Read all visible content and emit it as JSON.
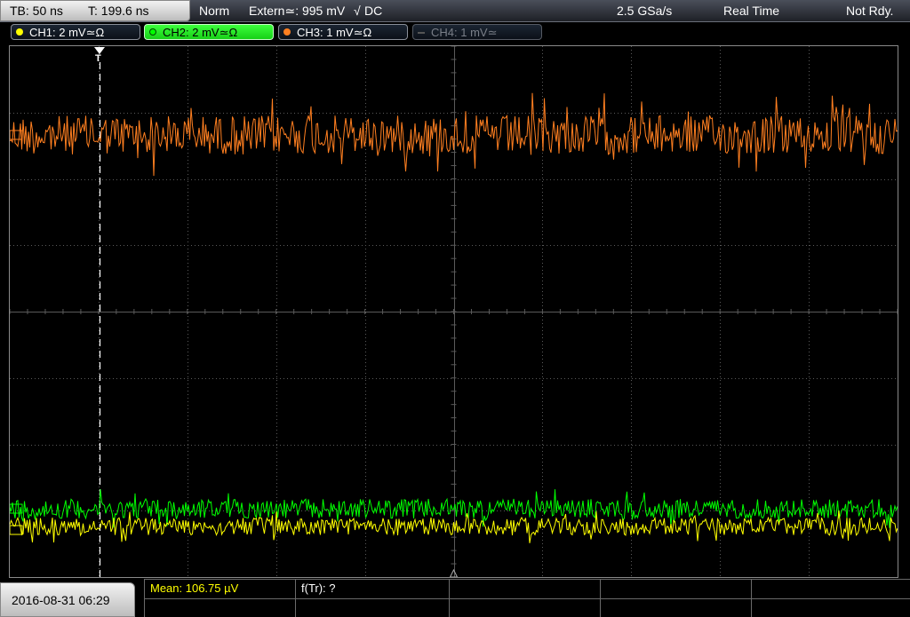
{
  "status": {
    "timebase": "TB: 50 ns",
    "trigger_time": "T: 199.6 ns",
    "mode": "Norm",
    "trigger_source": "Extern≃: 995 mV",
    "trigger_slope": "√",
    "trigger_coupling": "DC",
    "sample_rate": "2.5 GSa/s",
    "acq_mode": "Real Time",
    "state": "Not Rdy."
  },
  "channels": [
    {
      "label": "CH1: 2 mV≃Ω",
      "color": "#ffff00",
      "state": "on"
    },
    {
      "label": "CH2: 2 mV≃Ω",
      "color": "#00ff00",
      "state": "selected"
    },
    {
      "label": "CH3: 1 mV≃Ω",
      "color": "#ff7f20",
      "state": "on"
    },
    {
      "label": "CH4: 1 mV≃",
      "color": "#888888",
      "state": "off"
    }
  ],
  "trigger_marker": "T",
  "footer": {
    "datetime": "2016-08-31 06:29",
    "mean": "Mean: 106.75 µV",
    "freq": "f(Tr): ?"
  },
  "colors": {
    "ch1": "#ffff00",
    "ch2": "#00ff00",
    "ch3": "#ff7f20",
    "grid": "#5a5a5a",
    "trigger_line": "#ffffff"
  }
}
